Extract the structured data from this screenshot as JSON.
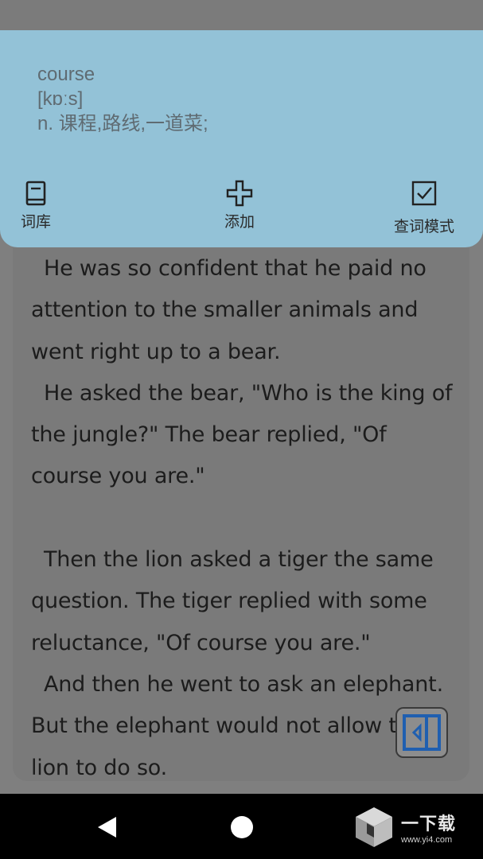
{
  "popup": {
    "word": "course",
    "phonetic": "[kɒːs]",
    "definition": "n. 课程,路线,一道菜;",
    "tools": {
      "library_label": "词库",
      "add_label": "添加",
      "lookup_mode_label": "查词模式"
    }
  },
  "reader": {
    "paragraphs": [
      "He was so confident that he paid no attention to the smaller animals and went right up to a bear.",
      "He asked the bear, \"Who is the king of the jungle?\" The bear replied, \"Of course you are.\"",
      "",
      "Then the lion asked a tiger the same question. The tiger replied with some reluctance, \"Of course you are.\"",
      "And then he went to ask an elephant. But the elephant would not allow the lion to do so."
    ]
  },
  "watermark": {
    "title": "一下载",
    "url": "www.yi4.com"
  },
  "icons": {
    "library": "book-icon",
    "add": "plus-icon",
    "lookup_mode": "checkbox-checked-icon",
    "side_toggle": "panel-collapse-icon",
    "nav_back": "back-triangle-icon",
    "nav_home": "home-circle-icon"
  },
  "colors": {
    "popup_bg": "#93c2d7",
    "toggle_accent": "#1f5fb0"
  }
}
